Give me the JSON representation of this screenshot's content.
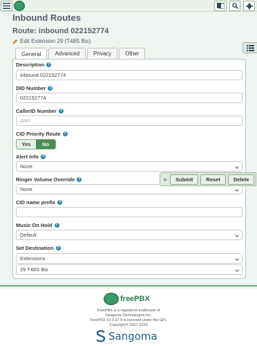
{
  "page": {
    "title": "Inbound Routes",
    "route_title": "Route: inbound 022152774",
    "edit_extension_link": "Edit Extension 29 (T48S Bis)"
  },
  "tabs": [
    {
      "label": "General",
      "active": true
    },
    {
      "label": "Advanced",
      "active": false
    },
    {
      "label": "Privacy",
      "active": false
    },
    {
      "label": "Other",
      "active": false
    }
  ],
  "form": {
    "description": {
      "label": "Description",
      "value": "inbound 022152774"
    },
    "did_number": {
      "label": "DID Number",
      "value": "022152774"
    },
    "callerid_number": {
      "label": "CallerID Number",
      "placeholder": "ANY"
    },
    "cid_priority": {
      "label": "CID Priority Route",
      "options": [
        "Yes",
        "No"
      ],
      "selected": "No"
    },
    "alert_info": {
      "label": "Alert Info",
      "value": "None"
    },
    "ringer_volume": {
      "label": "Ringer Volume Override",
      "value": "None"
    },
    "cid_name_prefix": {
      "label": "CID name prefix",
      "value": ""
    },
    "music_on_hold": {
      "label": "Music On Hold",
      "value": "Default"
    },
    "set_destination": {
      "label": "Set Destination",
      "type_value": "Extensions",
      "target_value": "29 T48S Bis"
    }
  },
  "actions": {
    "submit": "Submit",
    "reset": "Reset",
    "delete": "Delete"
  },
  "footer": {
    "brand": "freePBX",
    "line1": "FreePBX is a registered trademark of",
    "line2": "Sangoma Technologies Inc.",
    "line3": "FreePBX 15.0.37.9 is licensed under the GPL",
    "line4": "Copyright© 2007-2025",
    "company": "Sangoma"
  },
  "colors": {
    "accent_green": "#4b8c58",
    "brand_green": "#2d7a4f",
    "sangoma_blue": "#1e5a86"
  }
}
